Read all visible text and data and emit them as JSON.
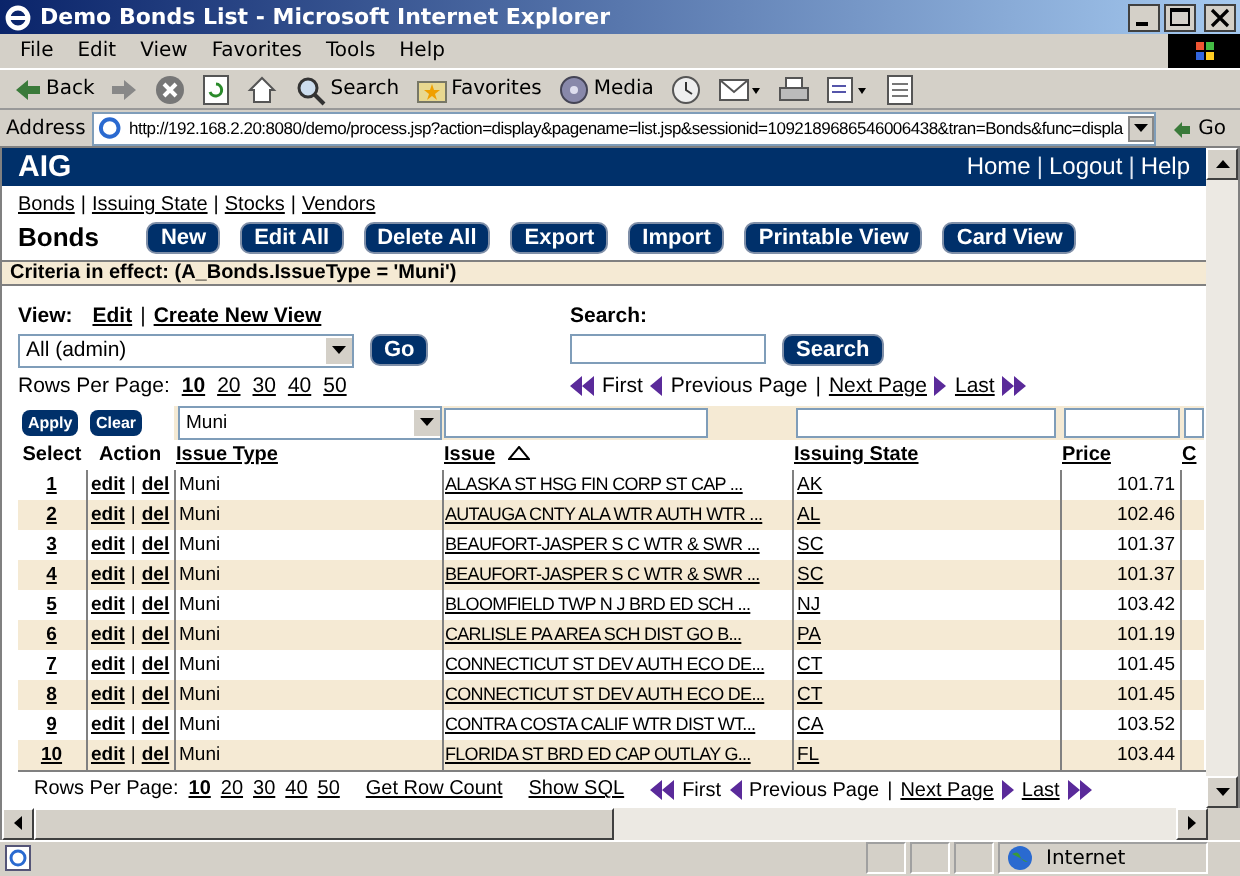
{
  "window": {
    "title": "Demo Bonds List - Microsoft Internet Explorer"
  },
  "menu": [
    "File",
    "Edit",
    "View",
    "Favorites",
    "Tools",
    "Help"
  ],
  "toolbar": [
    {
      "kind": "back",
      "label": "Back"
    },
    {
      "kind": "forward"
    },
    {
      "kind": "stop"
    },
    {
      "kind": "refresh"
    },
    {
      "kind": "home"
    },
    {
      "kind": "search",
      "label": "Search"
    },
    {
      "kind": "favorites",
      "label": "Favorites"
    },
    {
      "kind": "media",
      "label": "Media"
    },
    {
      "kind": "history"
    },
    {
      "kind": "mail"
    },
    {
      "kind": "print"
    },
    {
      "kind": "edit"
    },
    {
      "kind": "discuss"
    }
  ],
  "address": {
    "label": "Address",
    "url": "http://192.168.2.20:8080/demo/process.jsp?action=display&pagename=list.jsp&sessionid=1092189686546006438&tran=Bonds&func=displa",
    "go": "Go"
  },
  "header": {
    "logo": "AIG",
    "links": [
      {
        "kind": "link",
        "text": "Home"
      },
      {
        "kind": "sep",
        "text": "|"
      },
      {
        "kind": "link",
        "text": "Logout"
      },
      {
        "kind": "sep",
        "text": "|"
      },
      {
        "kind": "link",
        "text": "Help"
      }
    ]
  },
  "nav": [
    {
      "kind": "link",
      "text": "Bonds"
    },
    {
      "kind": "sep",
      "text": "|"
    },
    {
      "kind": "link",
      "text": "Issuing State"
    },
    {
      "kind": "sep",
      "text": "|"
    },
    {
      "kind": "link",
      "text": "Stocks"
    },
    {
      "kind": "sep",
      "text": "|"
    },
    {
      "kind": "link",
      "text": "Vendors"
    }
  ],
  "page_title": "Bonds",
  "actions": [
    "New",
    "Edit All",
    "Delete All",
    "Export",
    "Import",
    "Printable View",
    "Card View"
  ],
  "criteria": "Criteria in effect: (A_Bonds.IssueType = 'Muni')",
  "view": {
    "label": "View:",
    "links": [
      {
        "kind": "link",
        "text": "Edit"
      },
      {
        "kind": "sep",
        "text": "|"
      },
      {
        "kind": "link",
        "text": "Create New View"
      }
    ],
    "select": "All (admin)",
    "go": "Go"
  },
  "search": {
    "label": "Search:",
    "button": "Search"
  },
  "top_rows_per_page": {
    "label": "Rows Per Page:",
    "options": [
      {
        "text": "10",
        "selected": true
      },
      {
        "text": "20",
        "selected": false
      },
      {
        "text": "30",
        "selected": false
      },
      {
        "text": "40",
        "selected": false
      },
      {
        "text": "50",
        "selected": false
      }
    ]
  },
  "top_pager": [
    {
      "kind": "first",
      "text": "First",
      "disabled": true
    },
    {
      "kind": "prev",
      "text": "Previous Page",
      "disabled": true
    },
    {
      "kind": "sep",
      "text": "|"
    },
    {
      "kind": "next",
      "text": "Next Page",
      "disabled": false
    },
    {
      "kind": "last",
      "text": "Last",
      "disabled": false
    }
  ],
  "filter": {
    "apply": "Apply",
    "clear": "Clear",
    "issue_type": "Muni"
  },
  "table": {
    "columns": [
      {
        "text": "Select",
        "kind": "plain"
      },
      {
        "text": "Action",
        "kind": "plain"
      },
      {
        "text": "Issue Type",
        "kind": "link"
      },
      {
        "text": "Issue",
        "kind": "sorted"
      },
      {
        "text": "Issuing State",
        "kind": "link"
      },
      {
        "text": "Price",
        "kind": "link"
      },
      {
        "text": "C",
        "kind": "link"
      }
    ],
    "rows": [
      {
        "select": "1",
        "edit": "edit",
        "sep": "|",
        "del": "del",
        "issue_type": "Muni",
        "issue": "ALASKA ST HSG FIN CORP ST CAP ...",
        "state": "AK",
        "price": "101.71"
      },
      {
        "select": "2",
        "edit": "edit",
        "sep": "|",
        "del": "del",
        "issue_type": "Muni",
        "issue": "AUTAUGA CNTY ALA WTR AUTH WTR ...",
        "state": "AL",
        "price": "102.46"
      },
      {
        "select": "3",
        "edit": "edit",
        "sep": "|",
        "del": "del",
        "issue_type": "Muni",
        "issue": "BEAUFORT-JASPER S C WTR & SWR ...",
        "state": "SC",
        "price": "101.37"
      },
      {
        "select": "4",
        "edit": "edit",
        "sep": "|",
        "del": "del",
        "issue_type": "Muni",
        "issue": "BEAUFORT-JASPER S C WTR & SWR ...",
        "state": "SC",
        "price": "101.37"
      },
      {
        "select": "5",
        "edit": "edit",
        "sep": "|",
        "del": "del",
        "issue_type": "Muni",
        "issue": "BLOOMFIELD TWP N J BRD ED SCH ...",
        "state": "NJ",
        "price": "103.42"
      },
      {
        "select": "6",
        "edit": "edit",
        "sep": "|",
        "del": "del",
        "issue_type": "Muni",
        "issue": "CARLISLE PA AREA SCH DIST GO B...",
        "state": "PA",
        "price": "101.19"
      },
      {
        "select": "7",
        "edit": "edit",
        "sep": "|",
        "del": "del",
        "issue_type": "Muni",
        "issue": "CONNECTICUT ST DEV AUTH ECO DE...",
        "state": "CT",
        "price": "101.45"
      },
      {
        "select": "8",
        "edit": "edit",
        "sep": "|",
        "del": "del",
        "issue_type": "Muni",
        "issue": "CONNECTICUT ST DEV AUTH ECO DE...",
        "state": "CT",
        "price": "101.45"
      },
      {
        "select": "9",
        "edit": "edit",
        "sep": "|",
        "del": "del",
        "issue_type": "Muni",
        "issue": "CONTRA COSTA CALIF WTR DIST WT...",
        "state": "CA",
        "price": "103.52"
      },
      {
        "select": "10",
        "edit": "edit",
        "sep": "|",
        "del": "del",
        "issue_type": "Muni",
        "issue": "FLORIDA ST BRD ED CAP OUTLAY G...",
        "state": "FL",
        "price": "103.44"
      }
    ]
  },
  "bottom_rows_per_page": {
    "label": "Rows Per Page:",
    "options": [
      {
        "text": "10",
        "selected": true
      },
      {
        "text": "20",
        "selected": false
      },
      {
        "text": "30",
        "selected": false
      },
      {
        "text": "40",
        "selected": false
      },
      {
        "text": "50",
        "selected": false
      }
    ]
  },
  "bottom_links": [
    "Get Row Count",
    "Show SQL"
  ],
  "bottom_pager": [
    {
      "kind": "first",
      "text": "First",
      "disabled": true
    },
    {
      "kind": "prev",
      "text": "Previous Page",
      "disabled": true
    },
    {
      "kind": "sep",
      "text": "|"
    },
    {
      "kind": "next",
      "text": "Next Page",
      "disabled": false
    },
    {
      "kind": "last",
      "text": "Last",
      "disabled": false
    }
  ],
  "status": {
    "zone": "Internet"
  }
}
